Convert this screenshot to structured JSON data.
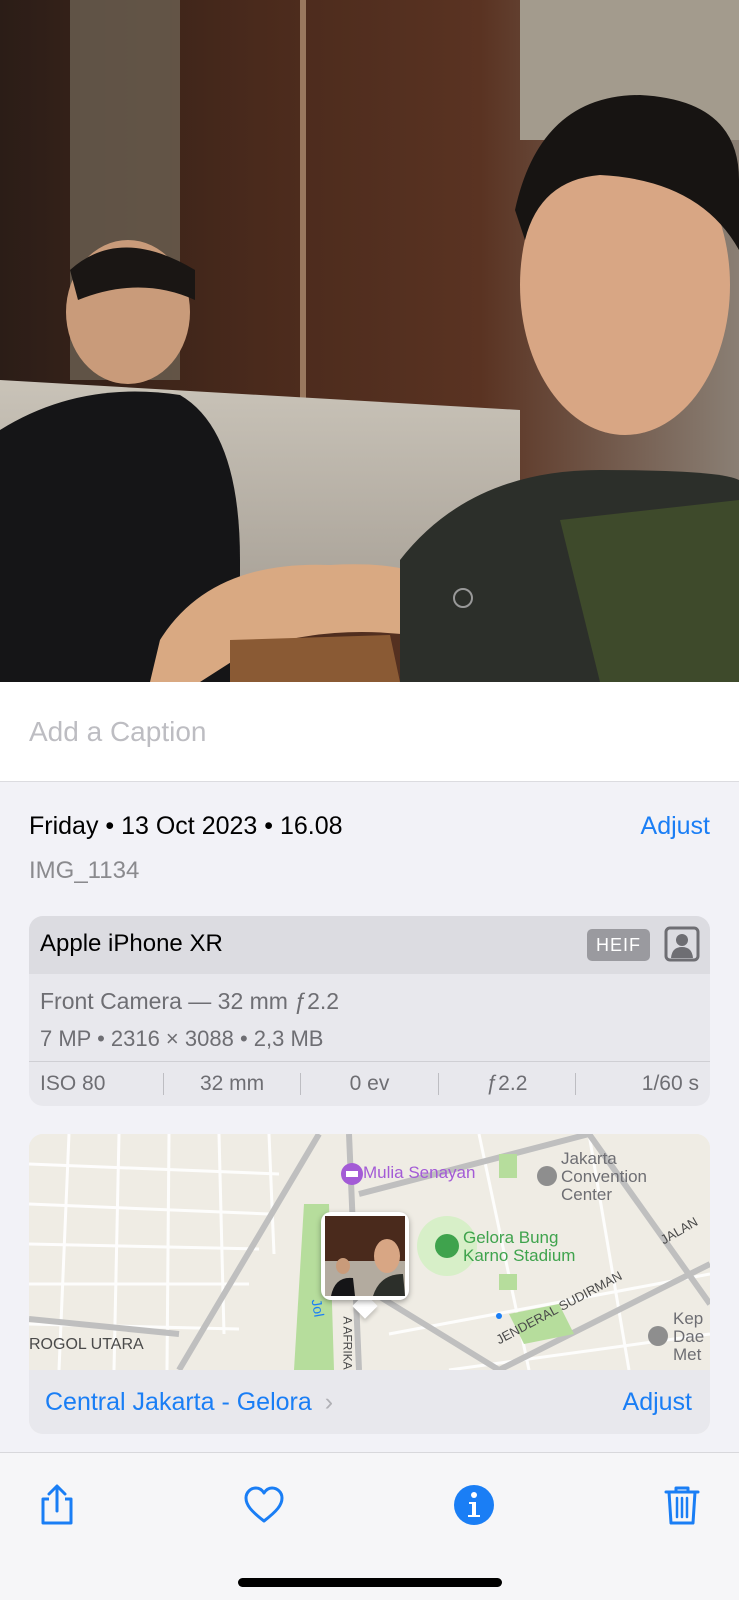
{
  "photo": {
    "description_icon": "photo-thumbnail"
  },
  "caption": {
    "placeholder": "Add a Caption",
    "value": ""
  },
  "info": {
    "date_time": "Friday • 13 Oct 2023 • 16.08",
    "adjust_label": "Adjust",
    "filename": "IMG_1134"
  },
  "camera": {
    "device": "Apple iPhone XR",
    "format_badge": "HEIF",
    "format_icon": "portrait-mode-icon",
    "lens": "Front Camera — 32 mm ƒ2.2",
    "specs": "7 MP  •  2316 × 3088  •  2,3 MB",
    "exif": {
      "iso": "ISO 80",
      "focal": "32 mm",
      "ev": "0 ev",
      "aperture": "ƒ2.2",
      "shutter": "1/60 s"
    }
  },
  "map": {
    "labels": {
      "mulia": "Mulia Senayan",
      "jcc_1": "Jakarta",
      "jcc_2": "Convention",
      "jcc_3": "Center",
      "gbk_1": "Gelora Bung",
      "gbk_2": "Karno Stadium",
      "rogol": "ROGOL UTARA",
      "jalan": "JALAN",
      "sudirman": "JENDERAL SUDIRMAN",
      "afrika": "A AFRIKA",
      "jol": "Jol",
      "kep_1": "Kep",
      "kep_2": "Dae",
      "kep_3": "Met"
    },
    "location_name": "Central Jakarta - Gelora",
    "adjust_label": "Adjust",
    "colors": {
      "poi_purple": "#a35bd6",
      "park_green": "#3fa34d",
      "link_blue": "#1a7ef5"
    }
  },
  "toolbar": {
    "share_icon": "share-icon",
    "favorite_icon": "heart-icon",
    "info_icon": "info-icon",
    "delete_icon": "trash-icon"
  }
}
